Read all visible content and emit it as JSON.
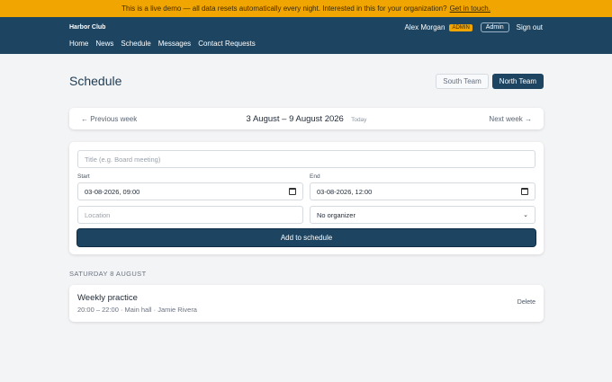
{
  "banner": {
    "text": "This is a live demo — all data resets automatically every night. Interested in this for your organization?",
    "link": "Get in touch."
  },
  "nav": {
    "brand": "Harbor Club",
    "links": [
      "Home",
      "News",
      "Schedule",
      "Messages",
      "Contact Requests"
    ],
    "user_name": "Alex Morgan",
    "role_badge": "ADMIN",
    "admin_button": "Admin",
    "sign_out": "Sign out"
  },
  "page": {
    "title": "Schedule",
    "teams": [
      {
        "label": "South Team",
        "active": false
      },
      {
        "label": "North Team",
        "active": true
      }
    ]
  },
  "week": {
    "prev": "← Previous week",
    "range": "3 August – 9 August 2026",
    "today": "Today",
    "next": "Next week →"
  },
  "form": {
    "title_placeholder": "Title (e.g. Board meeting)",
    "start_label": "Start",
    "start_value": "03-08-2026, 09:00",
    "end_label": "End",
    "end_value": "03-08-2026, 12:00",
    "location_placeholder": "Location",
    "organizer_value": "No organizer",
    "submit": "Add to schedule"
  },
  "days": [
    {
      "header": "SATURDAY 8 AUGUST",
      "events": [
        {
          "title": "Weekly practice",
          "meta": "20:00 – 22:00 · Main hall · Jamie Rivera",
          "delete": "Delete"
        }
      ]
    }
  ]
}
